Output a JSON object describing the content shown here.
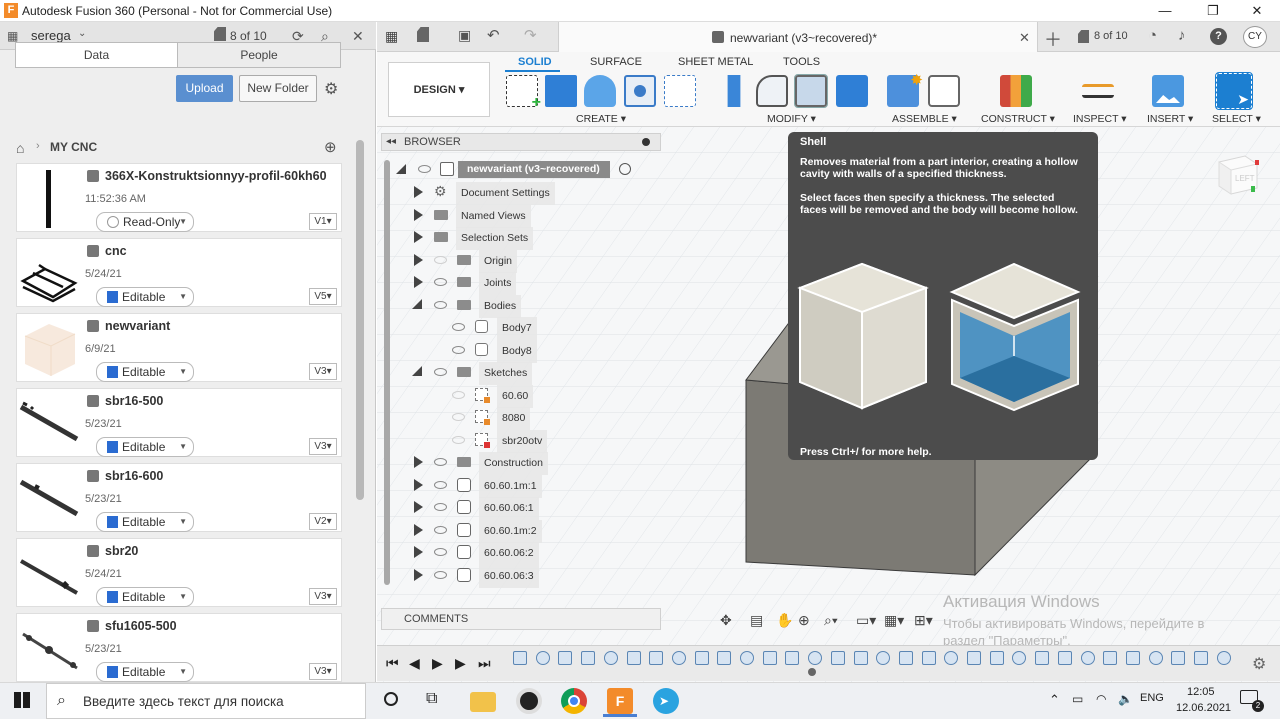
{
  "window": {
    "app_icon": "F",
    "title": "Autodesk Fusion 360 (Personal - Not for Commercial Use)",
    "controls": [
      "—",
      "❐",
      "✕"
    ]
  },
  "left_panel": {
    "user": "serega",
    "counter": "8 of 10",
    "tabs": [
      "Data",
      "People"
    ],
    "upload_label": "Upload",
    "new_folder_label": "New Folder",
    "breadcrumb": "MY CNC",
    "files": [
      {
        "name": "366X-Konstruktsionnyy-profil-60kh60",
        "date": "11:52:36 AM",
        "status": "Read-Only",
        "version": "V1"
      },
      {
        "name": "cnc",
        "date": "5/24/21",
        "status": "Editable",
        "version": "V5"
      },
      {
        "name": "newvariant",
        "date": "6/9/21",
        "status": "Editable",
        "version": "V3"
      },
      {
        "name": "sbr16-500",
        "date": "5/23/21",
        "status": "Editable",
        "version": "V3"
      },
      {
        "name": "sbr16-600",
        "date": "5/23/21",
        "status": "Editable",
        "version": "V2"
      },
      {
        "name": "sbr20",
        "date": "5/24/21",
        "status": "Editable",
        "version": "V3"
      },
      {
        "name": "sfu1605-500",
        "date": "5/23/21",
        "status": "Editable",
        "version": "V3"
      }
    ]
  },
  "doc": {
    "tab_title": "newvariant (v3~recovered)*",
    "counter": "8 of 10",
    "user_initials": "CY"
  },
  "toolbar": {
    "workspace": "DESIGN",
    "tabs": [
      "SOLID",
      "SURFACE",
      "SHEET METAL",
      "TOOLS"
    ],
    "groups": [
      "CREATE",
      "MODIFY",
      "ASSEMBLE",
      "CONSTRUCT",
      "INSPECT",
      "INSERT",
      "SELECT"
    ]
  },
  "browser": {
    "title": "BROWSER",
    "root": "newvariant (v3~recovered)",
    "nodes": [
      {
        "label": "Document Settings"
      },
      {
        "label": "Named Views"
      },
      {
        "label": "Selection Sets"
      },
      {
        "label": "Origin"
      },
      {
        "label": "Joints"
      },
      {
        "label": "Bodies"
      },
      {
        "label": "Body7"
      },
      {
        "label": "Body8"
      },
      {
        "label": "Sketches"
      },
      {
        "label": "60.60"
      },
      {
        "label": "8080"
      },
      {
        "label": "sbr20otv"
      },
      {
        "label": "Construction"
      },
      {
        "label": "60.60.1m:1"
      },
      {
        "label": "60.60.06:1"
      },
      {
        "label": "60.60.1m:2"
      },
      {
        "label": "60.60.06:2"
      },
      {
        "label": "60.60.06:3"
      }
    ],
    "comments": "COMMENTS"
  },
  "tooltip": {
    "title": "Shell",
    "desc1": "Removes material from a part interior, creating a hollow cavity with walls of a specified thickness.",
    "desc2": "Select faces then specify a thickness. The selected faces will be removed and the body will become hollow.",
    "help": "Press Ctrl+/ for more help."
  },
  "viewcube": {
    "label": "LEFT"
  },
  "watermark": {
    "title": "Активация Windows",
    "line1": "Чтобы активировать Windows, перейдите в",
    "line2": "раздел \"Параметры\"."
  },
  "taskbar": {
    "search_placeholder": "Введите здесь текст для поиска",
    "lang": "ENG",
    "time": "12:05",
    "date": "12.06.2021",
    "notif_count": "2"
  },
  "colors": {
    "accent": "#1c7fd1",
    "upload": "#5a8fd0",
    "tooltip_bg": "#4c4c4c",
    "model": "#7c7a74"
  }
}
